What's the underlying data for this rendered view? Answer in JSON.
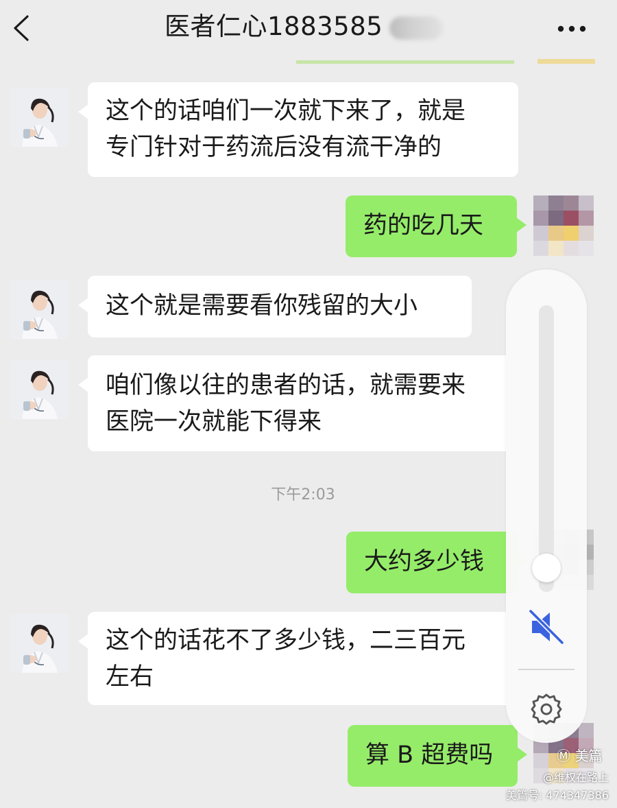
{
  "header": {
    "title": "医者仁心1883585",
    "back_icon": "chevron-left-icon",
    "more_icon": "more-dots-icon"
  },
  "messages": [
    {
      "side": "in",
      "lines": [
        "这个的话咱们一次就下来了，就是",
        "专门针对于药流后没有流干净的"
      ]
    },
    {
      "side": "out",
      "lines": [
        "药的吃几天"
      ]
    },
    {
      "side": "in",
      "lines": [
        "这个就是需要看你残留的大小"
      ]
    },
    {
      "side": "in",
      "lines": [
        "咱们像以往的患者的话，就需要来",
        "医院一次就能下得来"
      ]
    },
    {
      "side": "out",
      "lines": [
        "大约多少钱"
      ]
    },
    {
      "side": "in",
      "lines": [
        "这个的话花不了多少钱，二三百元",
        "左右"
      ]
    },
    {
      "side": "out",
      "lines": [
        "算 B 超费吗"
      ]
    }
  ],
  "timestamp": "下午2:03",
  "volume_panel": {
    "level": 0.02,
    "mute_icon": "speaker-muted-icon",
    "settings_icon": "gear-icon"
  },
  "watermark": {
    "logo_text": "美篇",
    "line1": "@维权在路上",
    "line2": "美篇号: 474347386"
  },
  "colors": {
    "background": "#ececec",
    "bubble_in": "#ffffff",
    "bubble_out": "#95ec69",
    "mute_blue": "#3b63e0"
  }
}
